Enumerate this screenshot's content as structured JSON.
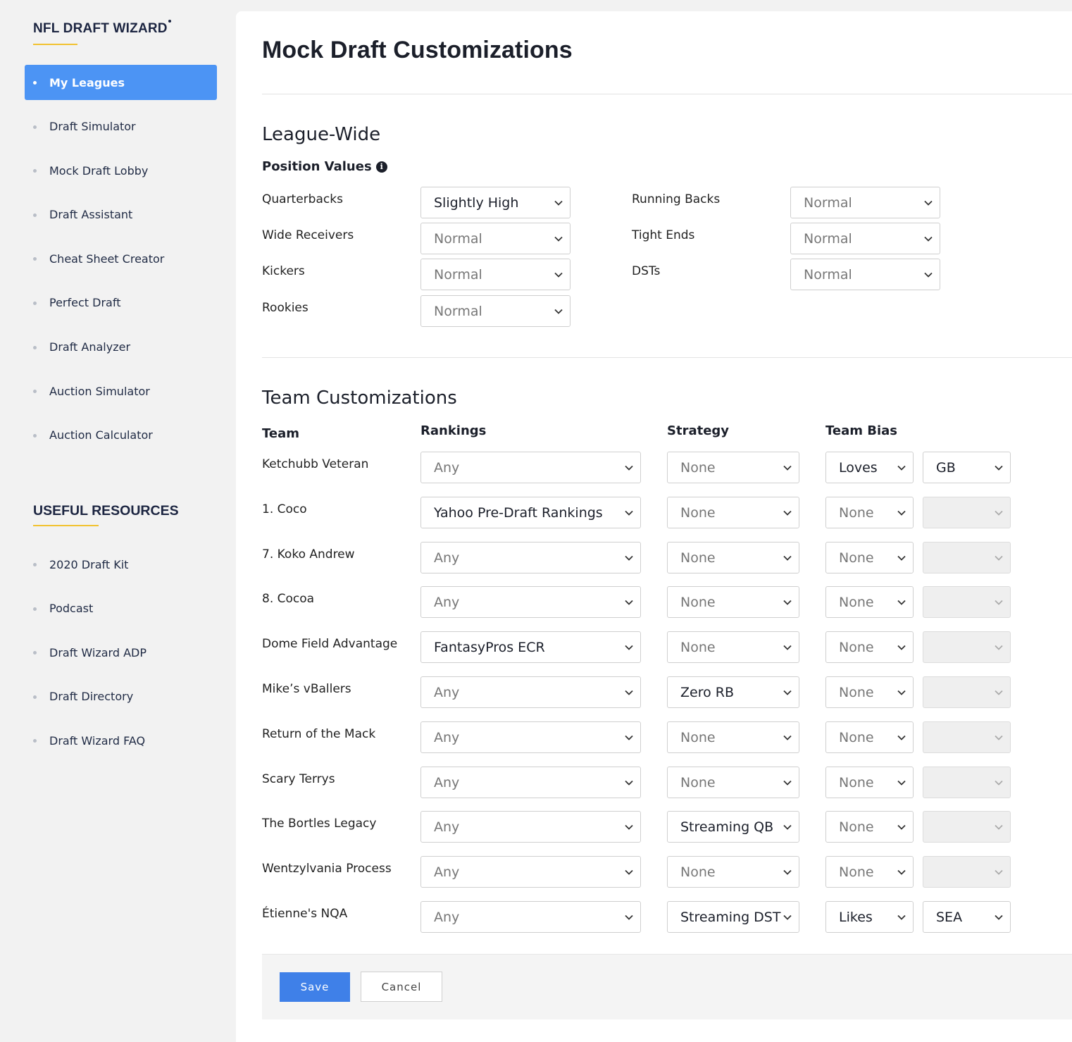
{
  "brand": {
    "name": "NFL DRAFT WIZARD"
  },
  "sidebar": {
    "items": [
      {
        "label": "My Leagues",
        "active": true
      },
      {
        "label": "Draft Simulator"
      },
      {
        "label": "Mock Draft Lobby"
      },
      {
        "label": "Draft Assistant"
      },
      {
        "label": "Cheat Sheet Creator"
      },
      {
        "label": "Perfect Draft"
      },
      {
        "label": "Draft Analyzer"
      },
      {
        "label": "Auction Simulator"
      },
      {
        "label": "Auction Calculator"
      }
    ],
    "resources_title": "USEFUL RESOURCES",
    "resources": [
      {
        "label": "2020 Draft Kit"
      },
      {
        "label": "Podcast"
      },
      {
        "label": "Draft Wizard ADP"
      },
      {
        "label": "Draft Directory"
      },
      {
        "label": "Draft Wizard FAQ"
      }
    ]
  },
  "main": {
    "title": "Mock Draft Customizations",
    "league_wide": {
      "title": "League-Wide",
      "position_values_label": "Position Values",
      "positions": [
        {
          "label": "Quarterbacks",
          "value": "Slightly High",
          "set": true
        },
        {
          "label": "Running Backs",
          "value": "Normal",
          "set": false
        },
        {
          "label": "Wide Receivers",
          "value": "Normal",
          "set": false
        },
        {
          "label": "Tight Ends",
          "value": "Normal",
          "set": false
        },
        {
          "label": "Kickers",
          "value": "Normal",
          "set": false
        },
        {
          "label": "DSTs",
          "value": "Normal",
          "set": false
        },
        {
          "label": "Rookies",
          "value": "Normal",
          "set": false
        }
      ]
    },
    "team_customizations": {
      "title": "Team Customizations",
      "headers": {
        "team": "Team",
        "rankings": "Rankings",
        "strategy": "Strategy",
        "team_bias": "Team Bias"
      },
      "rows": [
        {
          "team": "Ketchubb Veteran",
          "rankings": "Any",
          "strategy": "None",
          "bias": "Loves",
          "bias_team": "GB"
        },
        {
          "team": "1. Coco",
          "rankings": "Yahoo Pre-Draft Rankings",
          "strategy": "None",
          "bias": "None",
          "bias_team": ""
        },
        {
          "team": "7. Koko Andrew",
          "rankings": "Any",
          "strategy": "None",
          "bias": "None",
          "bias_team": ""
        },
        {
          "team": "8. Cocoa",
          "rankings": "Any",
          "strategy": "None",
          "bias": "None",
          "bias_team": ""
        },
        {
          "team": "Dome Field Advantage",
          "rankings": "FantasyPros ECR",
          "strategy": "None",
          "bias": "None",
          "bias_team": ""
        },
        {
          "team": "Mike’s vBallers",
          "rankings": "Any",
          "strategy": "Zero RB",
          "bias": "None",
          "bias_team": ""
        },
        {
          "team": "Return of the Mack",
          "rankings": "Any",
          "strategy": "None",
          "bias": "None",
          "bias_team": ""
        },
        {
          "team": "Scary Terrys",
          "rankings": "Any",
          "strategy": "None",
          "bias": "None",
          "bias_team": ""
        },
        {
          "team": "The Bortles Legacy",
          "rankings": "Any",
          "strategy": "Streaming QB",
          "bias": "None",
          "bias_team": ""
        },
        {
          "team": "Wentzylvania Process",
          "rankings": "Any",
          "strategy": "None",
          "bias": "None",
          "bias_team": ""
        },
        {
          "team": "Étienne's NQA",
          "rankings": "Any",
          "strategy": "Streaming DST",
          "bias": "Likes",
          "bias_team": "SEA"
        }
      ]
    },
    "footer": {
      "save_label": "Save",
      "cancel_label": "Cancel"
    }
  },
  "colors": {
    "accent": "#4c94f4",
    "save": "#3f80e8",
    "underline": "#f2c230"
  }
}
